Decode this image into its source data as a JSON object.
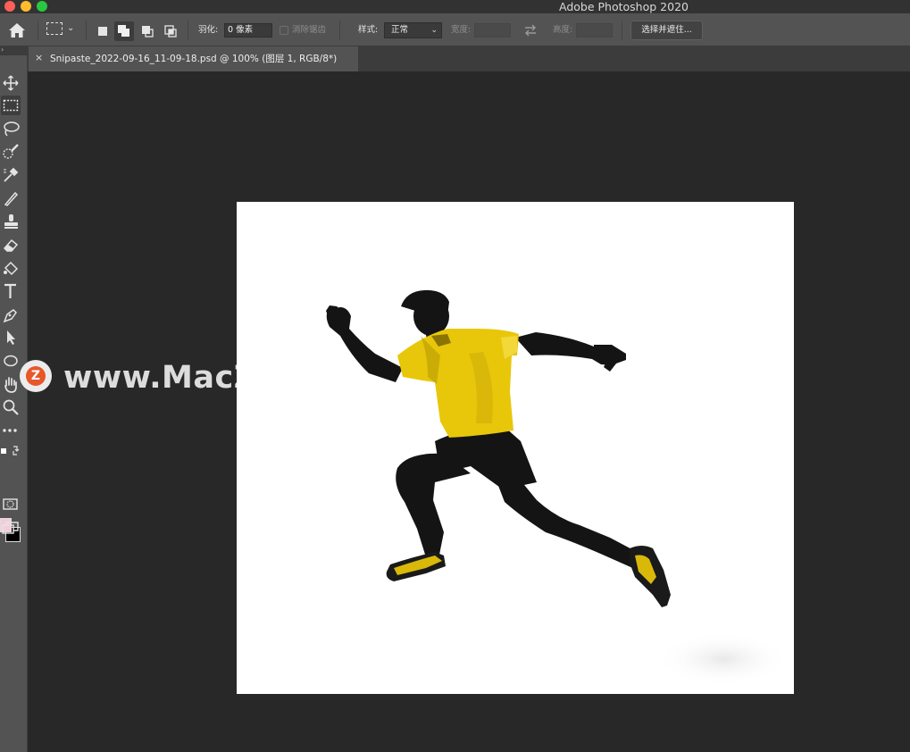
{
  "window": {
    "app_title": "Adobe Photoshop 2020"
  },
  "options_bar": {
    "feather_label": "羽化:",
    "feather_value": "0 像素",
    "anti_alias_label": "消除锯齿",
    "style_label": "样式:",
    "style_value": "正常",
    "width_label": "宽度:",
    "width_value": "",
    "height_label": "高度:",
    "height_value": "",
    "select_mask_button": "选择并遮住..."
  },
  "document_tab": {
    "close_glyph": "×",
    "title": "Snipaste_2022-09-16_11-09-18.psd @ 100% (图层 1, RGB/8*)"
  },
  "tools": [
    {
      "icon": "move-tool-icon"
    },
    {
      "icon": "rectangular-marquee-tool-icon",
      "active": true
    },
    {
      "icon": "lasso-tool-icon"
    },
    {
      "icon": "quick-selection-tool-icon"
    },
    {
      "icon": "eyedropper-tool-icon"
    },
    {
      "icon": "brush-tool-icon"
    },
    {
      "icon": "clone-stamp-tool-icon"
    },
    {
      "icon": "eraser-tool-icon"
    },
    {
      "icon": "paint-bucket-tool-icon"
    },
    {
      "icon": "type-tool-icon"
    },
    {
      "icon": "pen-tool-icon"
    },
    {
      "icon": "path-selection-tool-icon"
    },
    {
      "icon": "ellipse-tool-icon"
    },
    {
      "icon": "hand-tool-icon"
    },
    {
      "icon": "zoom-tool-icon"
    },
    {
      "icon": "more-tools-icon"
    }
  ],
  "colors": {
    "foreground": "#f4cdd8",
    "background": "#000000",
    "shirt": "#e8c70a",
    "canvas_bg": "#282828"
  },
  "watermark": {
    "logo_letter": "Z",
    "text": "www.MacZ.com"
  }
}
